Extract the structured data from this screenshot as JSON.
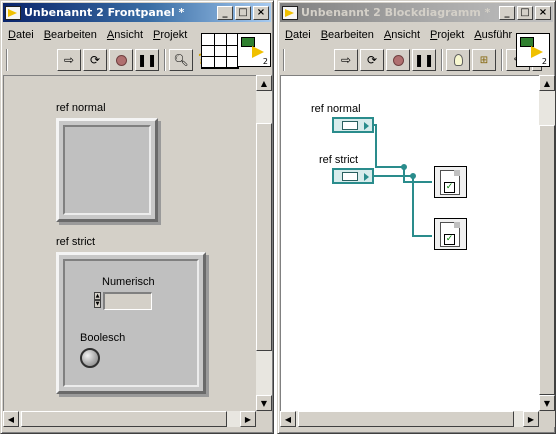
{
  "front": {
    "title": "Unbenannt 2 Frontpanel *",
    "menu": [
      "Datei",
      "Bearbeiten",
      "Ansicht",
      "Projekt"
    ],
    "connector_number": "2",
    "labels": {
      "ref_normal": "ref normal",
      "ref_strict": "ref strict",
      "numeric": "Numerisch",
      "boolean": "Boolesch"
    }
  },
  "block": {
    "title": "Unbenannt 2 Blockdiagramm *",
    "menu": [
      "Datei",
      "Bearbeiten",
      "Ansicht",
      "Projekt",
      "Ausführ"
    ],
    "connector_number": "2",
    "labels": {
      "ref_normal": "ref normal",
      "ref_strict": "ref strict"
    }
  },
  "caption_buttons": {
    "minimize": "_",
    "maximize": "□",
    "close": "×"
  },
  "colors": {
    "titlebar_active": "#0a246a",
    "titlebar_inactive": "#808080",
    "wire_refnum": "#2a8c8c",
    "panel_bg": "#d4d0c8"
  },
  "icons": {
    "run": "run-arrow-icon",
    "run_continuously": "run-continuously-icon",
    "abort": "abort-stop-icon",
    "pause": "pause-icon",
    "search": "search-magnifier-icon",
    "help": "context-help-icon",
    "highlight": "highlight-execution-bulb-icon",
    "retain": "retain-wire-values-icon",
    "step": "step-into-icon"
  }
}
